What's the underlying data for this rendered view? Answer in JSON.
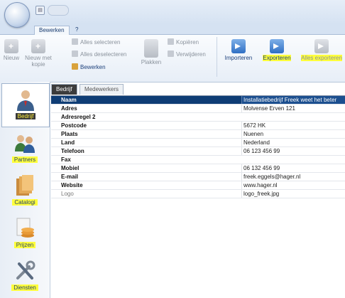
{
  "ribbon_tabs": [
    {
      "label": "Bewerken"
    },
    {
      "label": "?"
    }
  ],
  "ribbon": {
    "nieuw": "Nieuw",
    "nieuw_met_kopie": [
      "Nieuw met",
      "kopie"
    ],
    "alles_selecteren": "Alles selecteren",
    "alles_deselecteren": "Alles deselecteren",
    "bewerken": "Bewerken",
    "plakken": "Plakken",
    "kopieren": "Kopiëren",
    "verwijderen": "Verwijderen",
    "importeren": "Importeren",
    "exporteren": "Exporteren",
    "alles_exporteren": "Alles exporteren"
  },
  "nav": [
    {
      "label": "Bedrijf"
    },
    {
      "label": "Partners"
    },
    {
      "label": "Catalogi"
    },
    {
      "label": "Prijzen"
    },
    {
      "label": "Diensten"
    }
  ],
  "main_tabs": [
    {
      "label": "Bedrijf"
    },
    {
      "label": "Medewerkers"
    }
  ],
  "fields": [
    {
      "key": "Naam",
      "value": "Installatiebedrijf Freek weet het beter"
    },
    {
      "key": "Adres",
      "value": "Molvense Erven 121"
    },
    {
      "key": "Adresregel 2",
      "value": ""
    },
    {
      "key": "Postcode",
      "value": "5672 HK"
    },
    {
      "key": "Plaats",
      "value": "Nuenen"
    },
    {
      "key": "Land",
      "value": "Nederland"
    },
    {
      "key": "Telefoon",
      "value": "06 123 456 99"
    },
    {
      "key": "Fax",
      "value": ""
    },
    {
      "key": "Mobiel",
      "value": "06 132 456 99"
    },
    {
      "key": "E-mail",
      "value": "freek.eggels@hager.nl"
    },
    {
      "key": "Website",
      "value": "www.hager.nl"
    },
    {
      "key": "Logo",
      "value": "logo_freek.jpg"
    }
  ],
  "colors": {
    "highlight": "#ffff3c",
    "header_row": "#0f3d75",
    "ribbon_bg": "#e7eef7"
  }
}
